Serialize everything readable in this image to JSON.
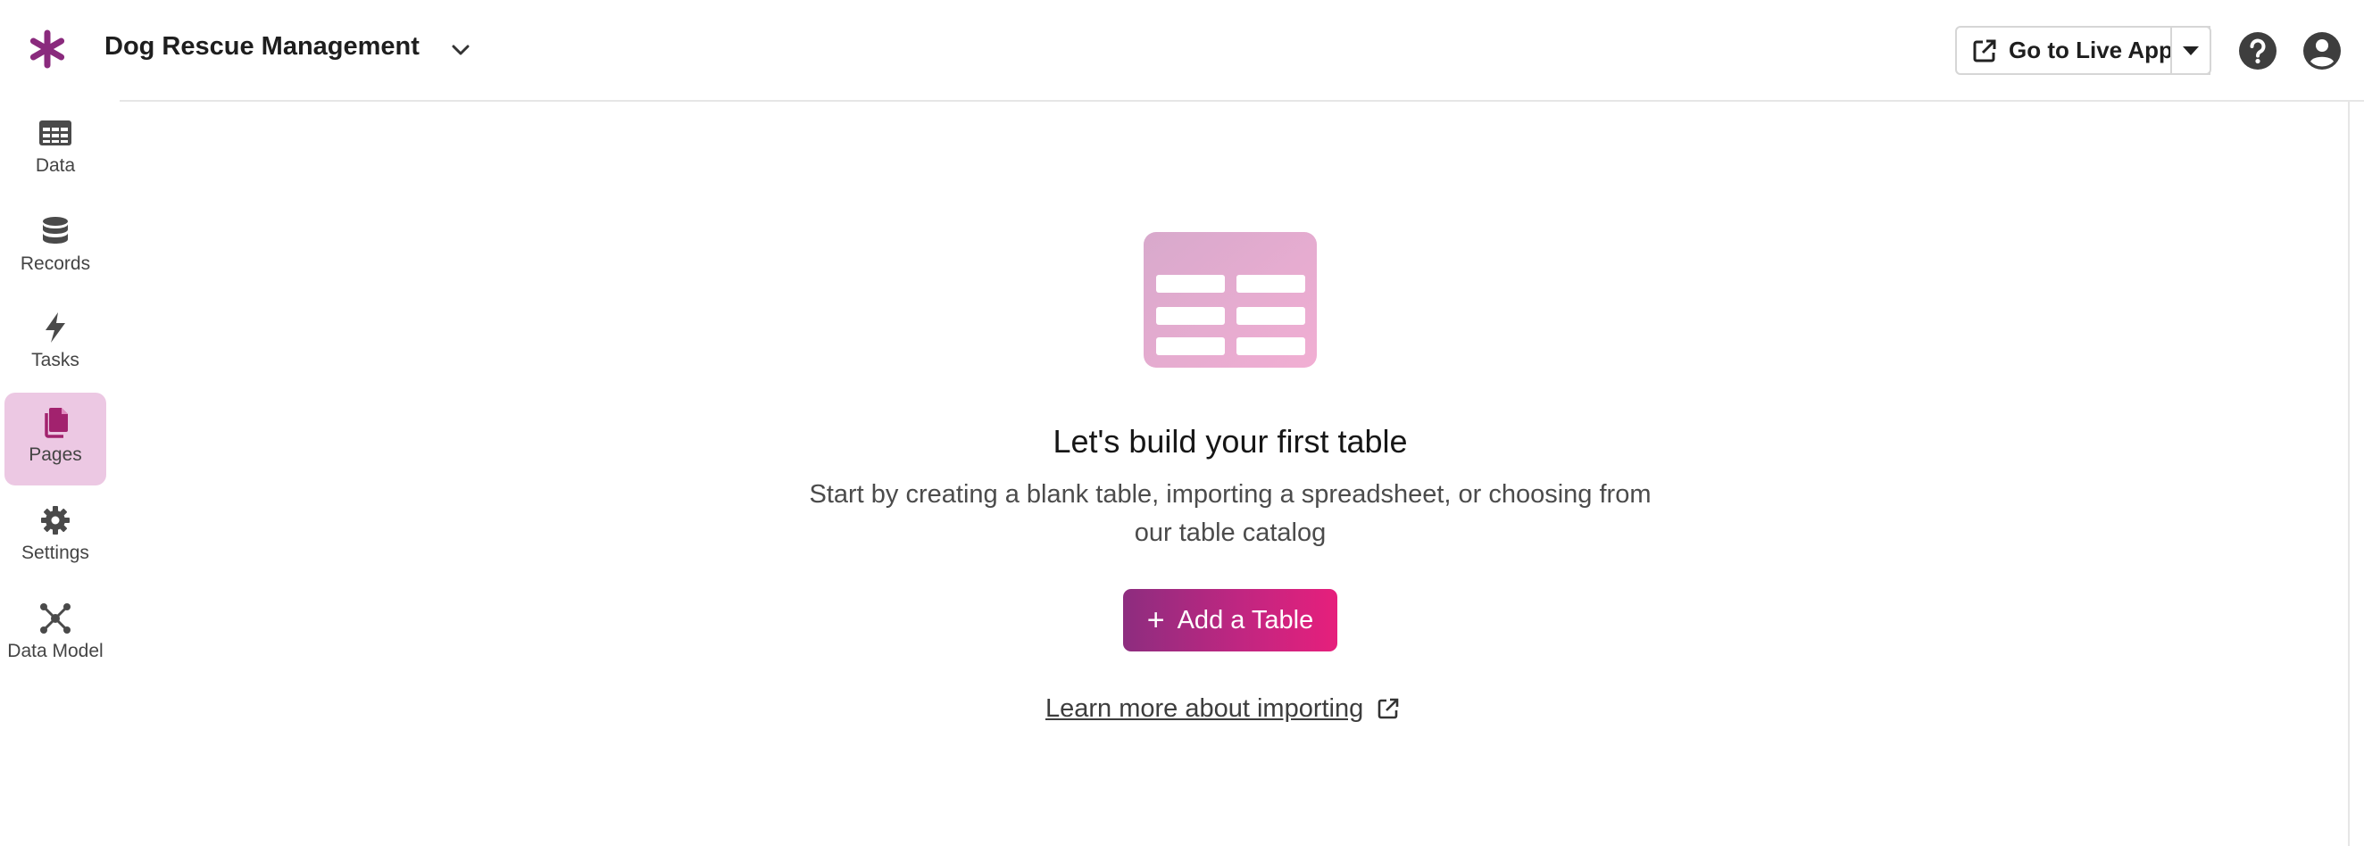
{
  "header": {
    "app_name": "Dog Rescue Management",
    "live_button_label": "Go to Live App"
  },
  "sidebar": {
    "items": [
      {
        "label": "Data",
        "icon": "table-icon",
        "active": false
      },
      {
        "label": "Records",
        "icon": "database-icon",
        "active": false
      },
      {
        "label": "Tasks",
        "icon": "lightning-icon",
        "active": false
      },
      {
        "label": "Pages",
        "icon": "pages-icon",
        "active": true
      },
      {
        "label": "Settings",
        "icon": "gear-icon",
        "active": false
      },
      {
        "label": "Data Model",
        "icon": "data-model-icon",
        "active": false
      }
    ]
  },
  "empty_state": {
    "title": "Let's build your first table",
    "description": "Start by creating a blank table, importing a spreadsheet, or choosing from our table catalog",
    "add_button_label": "Add a Table",
    "learn_link_label": "Learn more about importing"
  },
  "colors": {
    "brand": "#8d2d7f",
    "accent": "#e61f7c",
    "active_nav_bg": "#ecc8e3"
  }
}
